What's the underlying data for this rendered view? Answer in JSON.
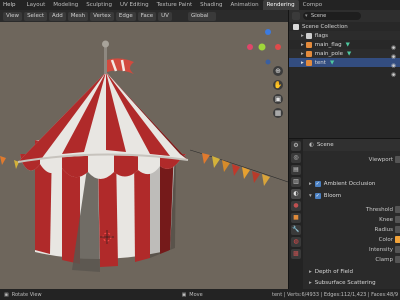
{
  "menu": {
    "help": "Help"
  },
  "tabs": [
    "Layout",
    "Modeling",
    "Sculpting",
    "UV Editing",
    "Texture Paint",
    "Shading",
    "Animation",
    "Rendering",
    "Compo"
  ],
  "active_tab": "Rendering",
  "viewport_header": {
    "buttons": [
      "View",
      "Select",
      "Add",
      "Mesh",
      "Vertex",
      "Edge",
      "Face",
      "UV"
    ],
    "transform_orientation": "Global"
  },
  "outliner": {
    "scene_label": "Scene",
    "collection": "Scene Collection",
    "items": [
      {
        "name": "flags",
        "icon": "collection-icon"
      },
      {
        "name": "main_flag",
        "icon": "mesh-icon"
      },
      {
        "name": "main_pole",
        "icon": "mesh-icon"
      },
      {
        "name": "tent",
        "icon": "mesh-icon",
        "selected": true
      }
    ]
  },
  "properties": {
    "scene_label": "Scene",
    "viewport_label": "Viewport",
    "panels": [
      {
        "title": "Ambient Occlusion",
        "enabled": true
      },
      {
        "title": "Bloom",
        "enabled": true
      }
    ],
    "bloom_fields": [
      "Threshold",
      "Knee",
      "Radius",
      "Color",
      "Intensity",
      "Clamp"
    ],
    "collapsed_panels": [
      "Depth of Field",
      "Subsurface Scattering"
    ],
    "bloom_color": "#f2a33a"
  },
  "status": {
    "left_action": "Rotate View",
    "middle_action": "Move",
    "stats": "tent | Verts:6/4933 | Edges:112/1,423 | Faces:48/9"
  },
  "colors": {
    "viewport_bg": "#6e665c",
    "tent_red": "#b02a2a",
    "tent_white": "#e8e6e2",
    "selection": "#334d80"
  }
}
